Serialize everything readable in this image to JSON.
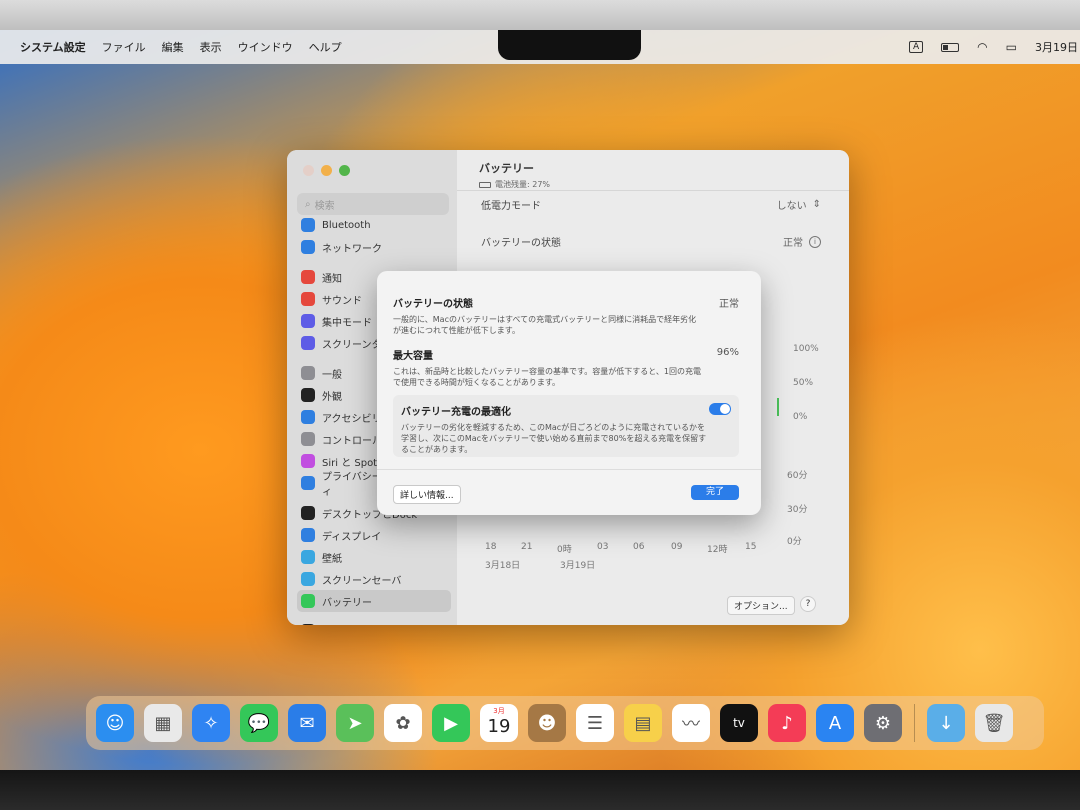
{
  "menubar": {
    "apple": "",
    "app_name": "システム設定",
    "menus": [
      "ファイル",
      "編集",
      "表示",
      "ウインドウ",
      "ヘルプ"
    ],
    "input_indicator": "A",
    "date": "3月19日"
  },
  "window": {
    "search_placeholder": "検索",
    "sidebar": [
      {
        "label": "Bluetooth",
        "icon": "bluetooth-icon",
        "color": "#2f7fe0"
      },
      {
        "label": "ネットワーク",
        "icon": "globe-icon",
        "color": "#2f7fe0"
      },
      {
        "label": "通知",
        "icon": "bell-icon",
        "color": "#e5483d",
        "gap": true
      },
      {
        "label": "サウンド",
        "icon": "speaker-icon",
        "color": "#e5483d"
      },
      {
        "label": "集中モード",
        "icon": "moon-icon",
        "color": "#5e5ce6"
      },
      {
        "label": "スクリーンタイム",
        "icon": "hourglass-icon",
        "color": "#5e5ce6"
      },
      {
        "label": "一般",
        "icon": "gear-icon",
        "color": "#8e8e93",
        "gap": true
      },
      {
        "label": "外観",
        "icon": "appearance-icon",
        "color": "#222222"
      },
      {
        "label": "アクセシビリティ",
        "icon": "accessibility-icon",
        "color": "#2f7fe0"
      },
      {
        "label": "コントロールセンター",
        "icon": "control-icon",
        "color": "#8e8e93"
      },
      {
        "label": "Siri と Spotlight",
        "icon": "siri-icon",
        "color": "#c14ee0"
      },
      {
        "label": "プライバシーとセキュリティ",
        "icon": "hand-icon",
        "color": "#2f7fe0"
      },
      {
        "label": "デスクトップとDock",
        "icon": "desktop-icon",
        "color": "#222222",
        "gap": true
      },
      {
        "label": "ディスプレイ",
        "icon": "display-icon",
        "color": "#2f7fe0"
      },
      {
        "label": "壁紙",
        "icon": "wallpaper-icon",
        "color": "#3aa7e0"
      },
      {
        "label": "スクリーンセーバ",
        "icon": "screensaver-icon",
        "color": "#3aa7e0"
      },
      {
        "label": "バッテリー",
        "icon": "battery-icon",
        "color": "#34c759",
        "active": true
      },
      {
        "label": "ロック画面",
        "icon": "lock-icon",
        "color": "#222222",
        "gap": true
      }
    ],
    "content": {
      "title": "バッテリー",
      "subtitle": "電池残量: 27%",
      "low_power_label": "低電力モード",
      "low_power_value": "しない",
      "battery_state_label": "バッテリーの状態",
      "battery_state_value": "正常",
      "chart": {
        "y_labels": [
          "100%",
          "50%",
          "0%"
        ],
        "y2_labels": [
          "60分",
          "30分",
          "0分"
        ],
        "x_labels": [
          "18",
          "21",
          "0時",
          "03",
          "06",
          "09",
          "12時",
          "15"
        ],
        "dates": [
          "3月18日",
          "3月19日"
        ]
      },
      "options_button": "オプション...",
      "help_button": "?"
    }
  },
  "dialog": {
    "sections": [
      {
        "title": "バッテリーの状態",
        "value": "正常",
        "desc": "一般的に、Macのバッテリーはすべての充電式バッテリーと同様に消耗品で経年劣化が進むにつれて性能が低下します。"
      },
      {
        "title": "最大容量",
        "value": "96%",
        "desc": "これは、新品時と比較したバッテリー容量の基準です。容量が低下すると、1回の充電で使用できる時間が短くなることがあります。"
      }
    ],
    "optimize": {
      "title": "バッテリー充電の最適化",
      "enabled": true,
      "desc": "バッテリーの劣化を軽減するため、このMacが日ごろどのように充電されているかを学習し、次にこのMacをバッテリーで使い始める直前まで80%を超える充電を保留することがあります。"
    },
    "details_button": "詳しい情報...",
    "done_button": "完了"
  },
  "dock": [
    {
      "name": "finder-icon",
      "color": "#2b8ef0",
      "glyph": "☺"
    },
    {
      "name": "launchpad-icon",
      "color": "#e9e9e9",
      "glyph": "▦"
    },
    {
      "name": "safari-icon",
      "color": "#2f84f2",
      "glyph": "✧"
    },
    {
      "name": "messages-icon",
      "color": "#34c759",
      "glyph": "💬"
    },
    {
      "name": "mail-icon",
      "color": "#2a7de8",
      "glyph": "✉"
    },
    {
      "name": "maps-icon",
      "color": "#5ac05a",
      "glyph": "➤"
    },
    {
      "name": "photos-icon",
      "color": "#ffffff",
      "glyph": "✿"
    },
    {
      "name": "facetime-icon",
      "color": "#34c759",
      "glyph": "▶"
    },
    {
      "name": "calendar-icon",
      "color": "#ffffff",
      "month": "3月",
      "day": "19"
    },
    {
      "name": "contacts-icon",
      "color": "#a57845",
      "glyph": "☻"
    },
    {
      "name": "reminders-icon",
      "color": "#ffffff",
      "glyph": "☰"
    },
    {
      "name": "notes-icon",
      "color": "#f7d04a",
      "glyph": "▤"
    },
    {
      "name": "freeform-icon",
      "color": "#ffffff",
      "glyph": "〰"
    },
    {
      "name": "appletv-icon",
      "color": "#111111",
      "glyph": "tv"
    },
    {
      "name": "music-icon",
      "color": "#f43c56",
      "glyph": "♪"
    },
    {
      "name": "appstore-icon",
      "color": "#2a84f2",
      "glyph": "A"
    },
    {
      "name": "systemsettings-icon",
      "color": "#6e6e73",
      "glyph": "⚙"
    },
    {
      "name": "downloads-folder-icon",
      "color": "#5aaee8",
      "glyph": "↓",
      "after_sep": true
    },
    {
      "name": "trash-icon",
      "color": "#e8e8e8",
      "glyph": "🗑"
    }
  ]
}
